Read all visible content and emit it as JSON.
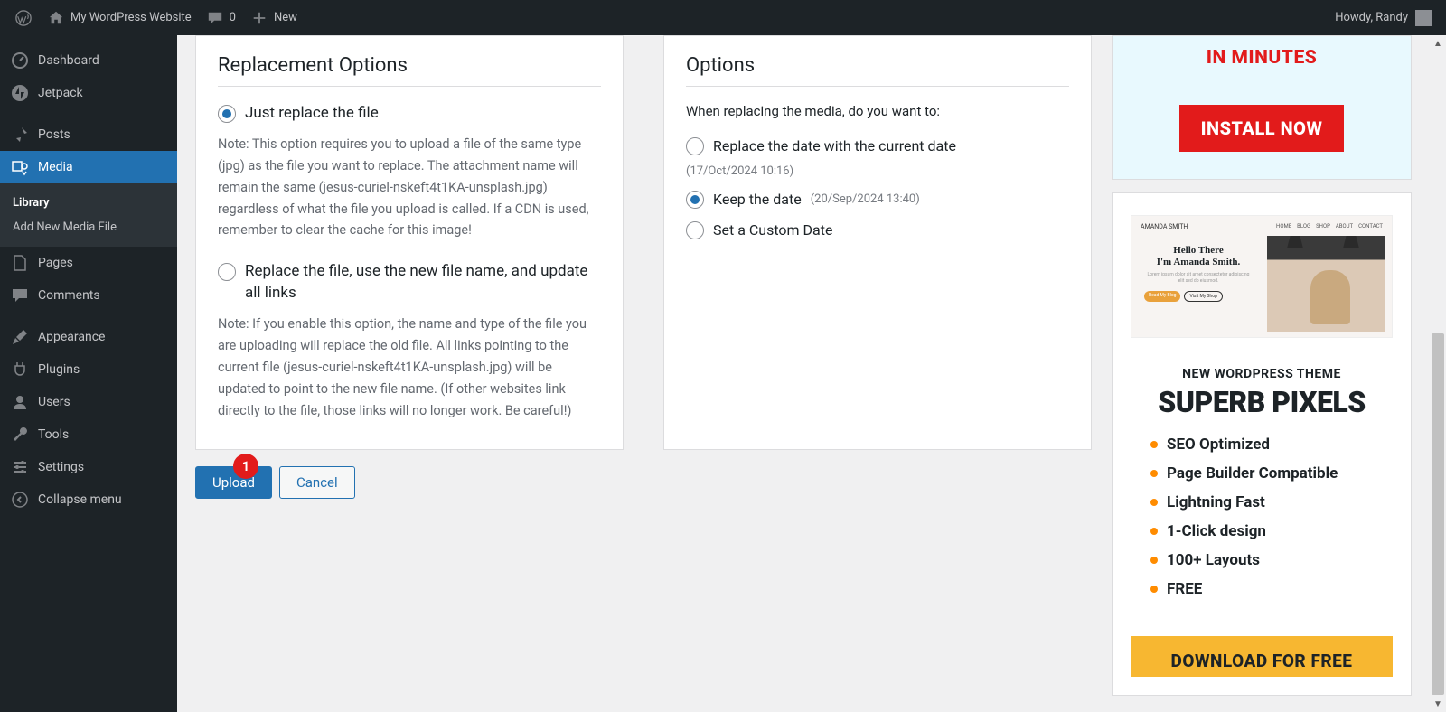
{
  "adminbar": {
    "site_title": "My WordPress Website",
    "comments_count": "0",
    "new_label": "New",
    "howdy": "Howdy, Randy"
  },
  "sidebar": {
    "items": [
      {
        "label": "Dashboard",
        "icon": "dashboard"
      },
      {
        "label": "Jetpack",
        "icon": "jetpack"
      },
      {
        "label": "Posts",
        "icon": "pin"
      },
      {
        "label": "Media",
        "icon": "media",
        "active": true
      },
      {
        "label": "Pages",
        "icon": "page"
      },
      {
        "label": "Comments",
        "icon": "comment"
      },
      {
        "label": "Appearance",
        "icon": "brush"
      },
      {
        "label": "Plugins",
        "icon": "plug"
      },
      {
        "label": "Users",
        "icon": "user"
      },
      {
        "label": "Tools",
        "icon": "wrench"
      },
      {
        "label": "Settings",
        "icon": "settings"
      }
    ],
    "submenu": {
      "library": "Library",
      "add_new": "Add New Media File"
    },
    "collapse": "Collapse menu"
  },
  "replacement": {
    "heading": "Replacement Options",
    "opt1_label": "Just replace the file",
    "opt1_note": "Note: This option requires you to upload a file of the same type (jpg) as the file you want to replace. The attachment name will remain the same (jesus-curiel-nskeft4t1KA-unsplash.jpg) regardless of what the file you upload is called. If a CDN is used, remember to clear the cache for this image!",
    "opt2_label": "Replace the file, use the new file name, and update all links",
    "opt2_note": "Note: If you enable this option, the name and type of the file you are uploading will replace the old file. All links pointing to the current file (jesus-curiel-nskeft4t1KA-unsplash.jpg) will be updated to point to the new file name. (If other websites link directly to the file, those links will no longer work. Be careful!)"
  },
  "options": {
    "heading": "Options",
    "subtext": "When replacing the media, do you want to:",
    "opt1_label": "Replace the date with the current date",
    "opt1_hint": "(17/Oct/2024 10:16)",
    "opt2_label": "Keep the date",
    "opt2_hint": "(20/Sep/2024 13:40)",
    "opt3_label": "Set a Custom Date"
  },
  "buttons": {
    "upload": "Upload",
    "cancel": "Cancel",
    "badge": "1"
  },
  "promo_top": {
    "title": "IN MINUTES",
    "cta": "INSTALL NOW"
  },
  "promo_theme": {
    "preview_name": "AMANDA SMITH",
    "preview_hello": "Hello There",
    "preview_im": "I'm Amanda Smith.",
    "preview_b1": "Read My Blog",
    "preview_b2": "Visit My Shop",
    "sub": "NEW WORDPRESS THEME",
    "big": "SUPERB PIXELS",
    "features": [
      "SEO Optimized",
      "Page Builder Compatible",
      "Lightning Fast",
      "1-Click design",
      "100+ Layouts",
      "FREE"
    ],
    "download": "DOWNLOAD FOR FREE"
  }
}
